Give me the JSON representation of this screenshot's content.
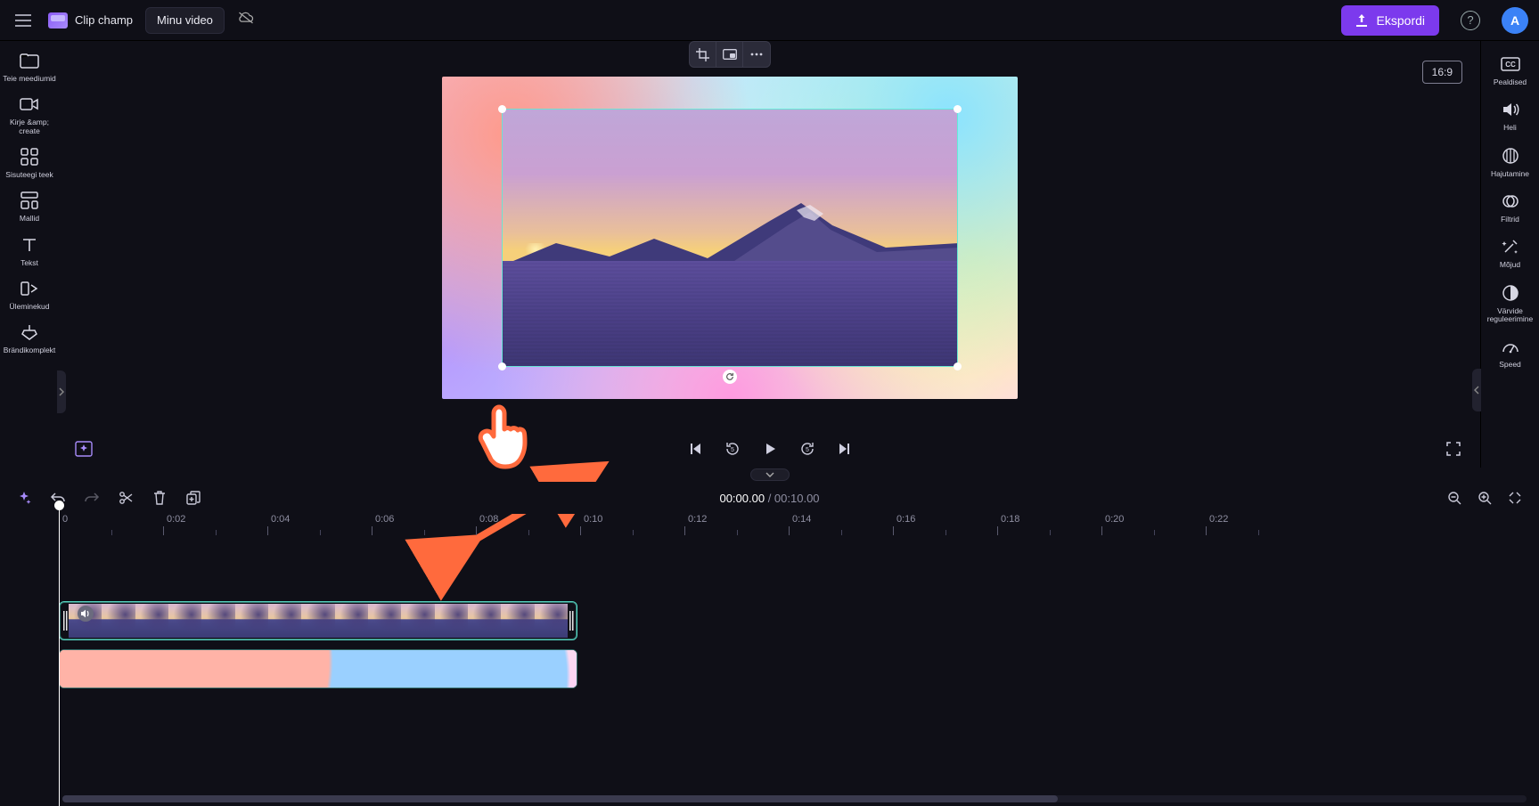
{
  "app": {
    "name": "Clip champ"
  },
  "project": {
    "name": "Minu video"
  },
  "export": {
    "label": "Ekspordi"
  },
  "avatar": {
    "initial": "A"
  },
  "aspect": {
    "label": "16:9"
  },
  "leftnav": [
    {
      "label": "Teie meediumid"
    },
    {
      "label": "Kirje &amp; create"
    },
    {
      "label": "Sisuteegi teek"
    },
    {
      "label": "Mallid"
    },
    {
      "label": "Tekst"
    },
    {
      "label": "Üleminekud"
    },
    {
      "label": "Brändikomplekt"
    }
  ],
  "rightnav": [
    {
      "label": "Pealdised"
    },
    {
      "label": "Heli"
    },
    {
      "label": "Hajutamine"
    },
    {
      "label": "Filtrid"
    },
    {
      "label": "Mõjud"
    },
    {
      "label": "Värvide reguleerimine"
    },
    {
      "label": "Speed"
    }
  ],
  "time": {
    "current": "00:00.00",
    "separator": " / ",
    "duration": "00:10.00"
  },
  "ruler": [
    "0",
    "0:02",
    "0:04",
    "0:06",
    "0:08",
    "0:10",
    "0:12",
    "0:14",
    "0:16",
    "0:18",
    "0:20",
    "0:22"
  ]
}
